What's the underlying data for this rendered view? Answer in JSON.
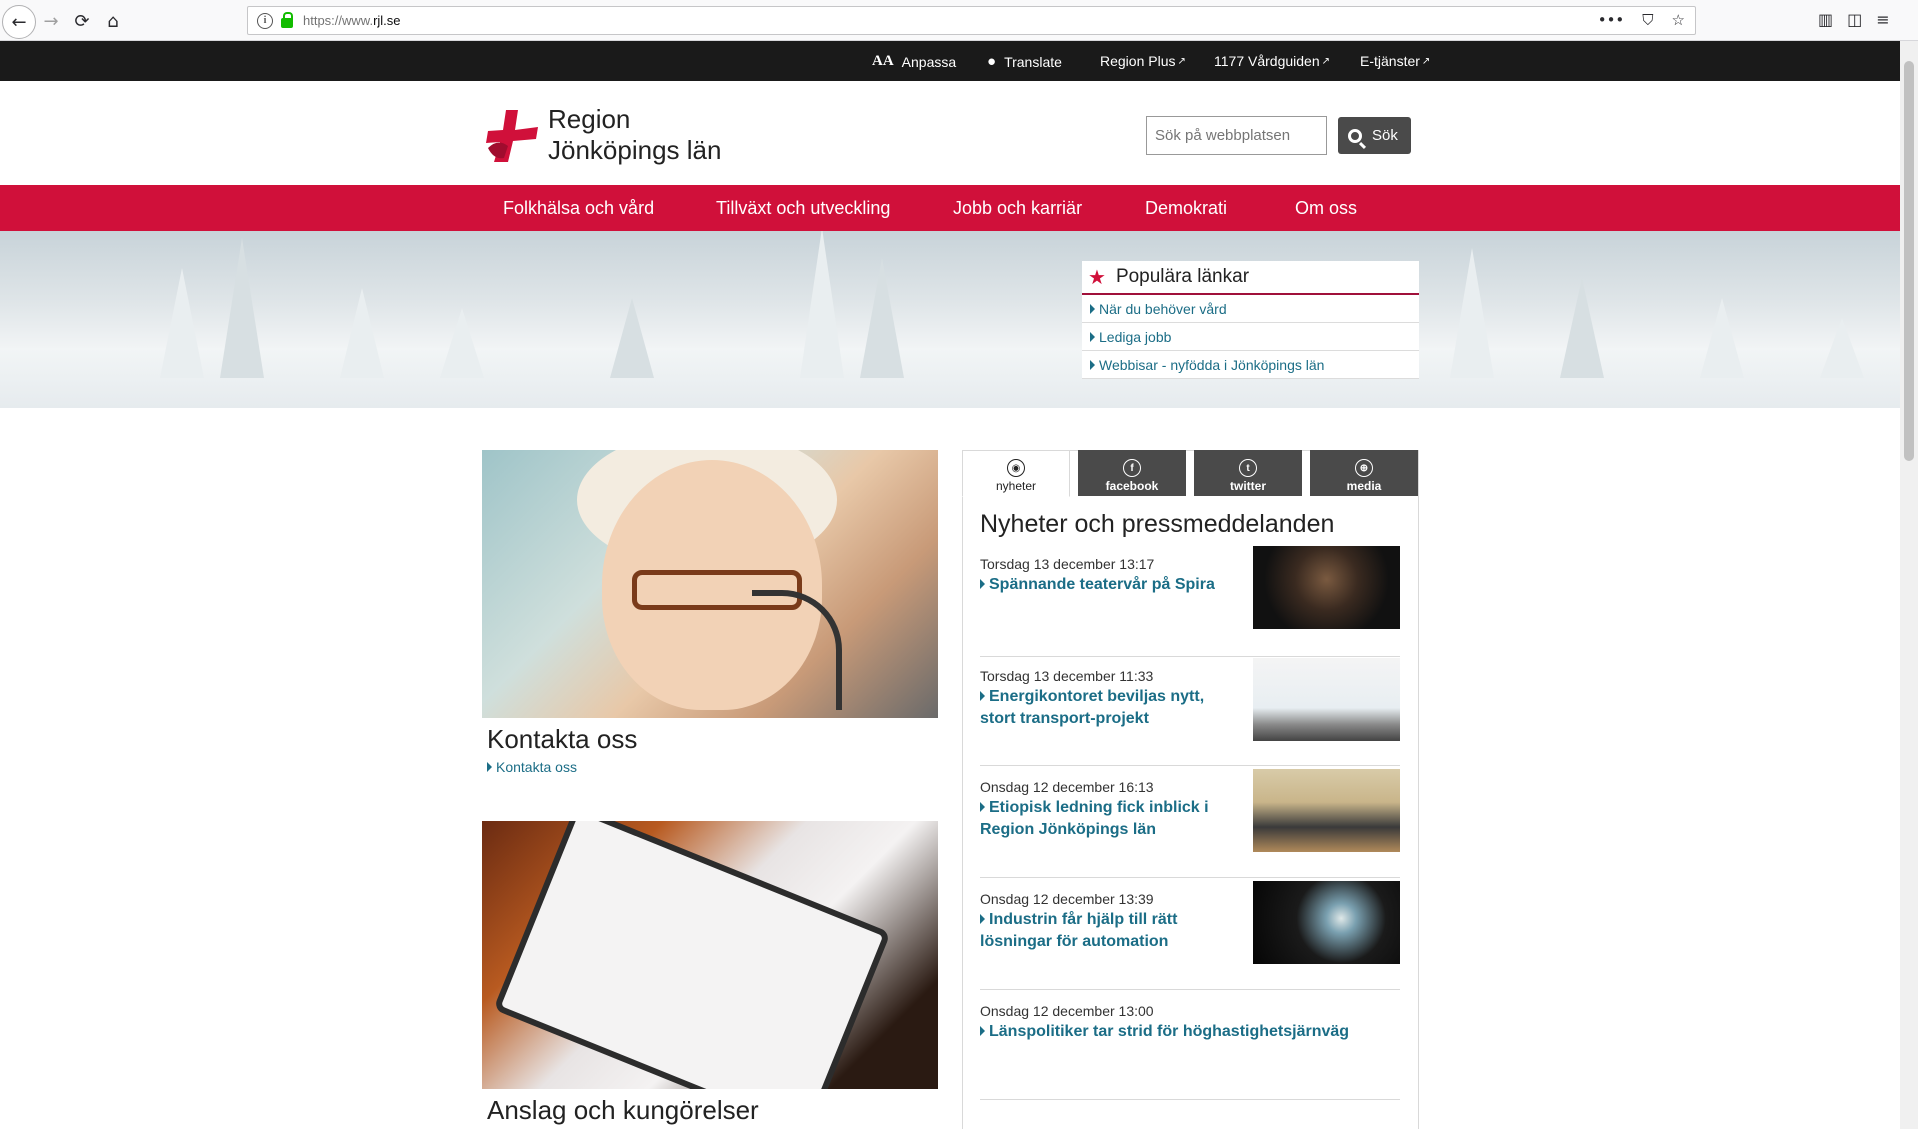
{
  "browser": {
    "url_prefix": "https://www.",
    "url_domain": "rjl.se",
    "more_icon": "•••"
  },
  "utility_bar": {
    "items": [
      {
        "label": "Anpassa",
        "icon": "text-size-icon"
      },
      {
        "label": "Translate",
        "icon": "globe-icon"
      },
      {
        "label": "Region Plus",
        "icon": "external-link-icon"
      },
      {
        "label": "1177 Vårdguiden",
        "icon": "external-link-icon"
      },
      {
        "label": "E-tjänster",
        "icon": "external-link-icon"
      }
    ]
  },
  "header": {
    "logo_line1": "Region",
    "logo_line2": "Jönköpings län",
    "search_placeholder": "Sök på webbplatsen",
    "search_button": "Sök"
  },
  "main_nav": {
    "items": [
      "Folkhälsa och vård",
      "Tillväxt och utveckling",
      "Jobb och karriär",
      "Demokrati",
      "Om oss"
    ]
  },
  "popular": {
    "title": "Populära länkar",
    "links": [
      "När du behöver vård",
      "Lediga jobb",
      "Webbisar - nyfödda i Jönköpings län"
    ]
  },
  "cards": [
    {
      "title": "Kontakta oss",
      "link": "Kontakta oss"
    },
    {
      "title": "Anslag och kungörelser"
    }
  ],
  "news": {
    "tabs": [
      "nyheter",
      "facebook",
      "twitter",
      "media"
    ],
    "heading": "Nyheter och pressmeddelanden",
    "items": [
      {
        "date": "Torsdag 13 december 13:17",
        "title": "Spännande teatervår på Spira"
      },
      {
        "date": "Torsdag 13 december 11:33",
        "title": "Energikontoret beviljas nytt, stort transport-projekt"
      },
      {
        "date": "Onsdag 12 december 16:13",
        "title": "Etiopisk ledning fick inblick i Region Jönköpings län"
      },
      {
        "date": "Onsdag 12 december 13:39",
        "title": "Industrin får hjälp till rätt lösningar för automation"
      },
      {
        "date": "Onsdag 12 december 13:00",
        "title": "Länspolitiker tar strid för höghastighetsjärnväg"
      }
    ]
  },
  "colors": {
    "brand_red": "#d0103a",
    "link_teal": "#1b6d86",
    "dark_bar": "#1a1a1a"
  }
}
